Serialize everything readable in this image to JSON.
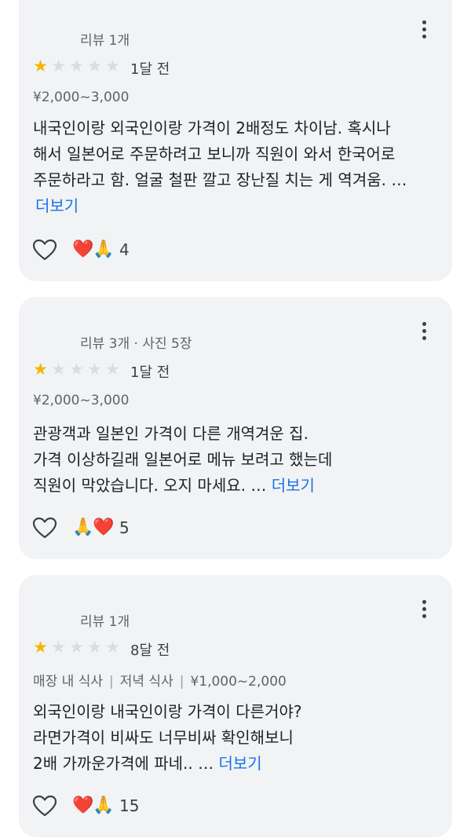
{
  "reviews": [
    {
      "author_meta": "리뷰 1개",
      "rating": 1,
      "when": "1달 전",
      "sub_items": [
        "¥2,000~3,000"
      ],
      "lines": [
        "내국인이랑 외국인이랑 가격이 2배정도 차이남. 혹시나",
        "해서 일본어로 주문하려고 보니까 직원이 와서 한국어로",
        "주문하라고 함. 얼굴 철판 깔고 장난질 치는 게 역겨움. …"
      ],
      "more_label": "더보기",
      "reactions": [
        "❤️",
        "🙏"
      ],
      "reaction_count": "4"
    },
    {
      "author_meta": "리뷰 3개 · 사진 5장",
      "rating": 1,
      "when": "1달 전",
      "sub_items": [
        "¥2,000~3,000"
      ],
      "lines": [
        "관광객과 일본인 가격이 다른 개역겨운 집.",
        "가격 이상하길래 일본어로 메뉴 보려고 했는데",
        "직원이 막았습니다. 오지 마세요. …"
      ],
      "more_label": "더보기",
      "reactions": [
        "🙏",
        "❤️"
      ],
      "reaction_count": "5"
    },
    {
      "author_meta": "리뷰 1개",
      "rating": 1,
      "when": "8달 전",
      "sub_items": [
        "매장 내 식사",
        "저녁 식사",
        "¥1,000~2,000"
      ],
      "lines": [
        "외국인이랑 내국인이랑 가격이 다른거야?",
        "라면가격이 비싸도 너무비싸 확인해보니",
        "2배 가까운가격에 파네.. …"
      ],
      "more_label": "더보기",
      "reactions": [
        "❤️",
        "🙏"
      ],
      "reaction_count": "15"
    }
  ],
  "colors": {
    "star": "#f6b400",
    "link": "#1a73e8",
    "card": "#f1f3f4"
  }
}
